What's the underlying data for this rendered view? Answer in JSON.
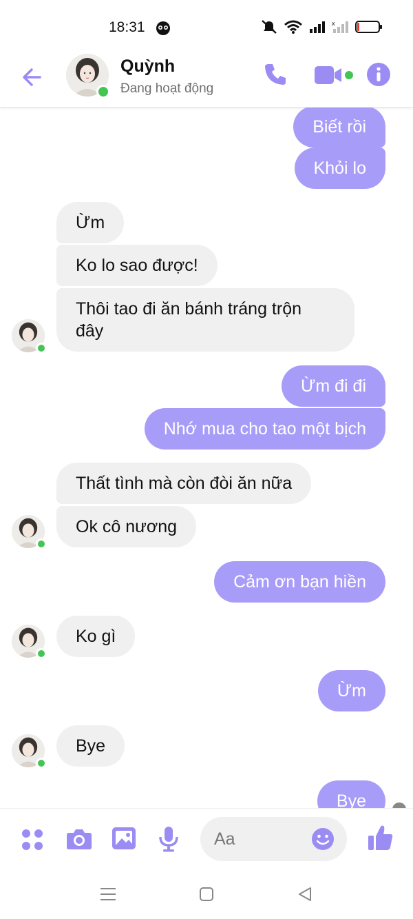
{
  "status_bar": {
    "time": "18:31"
  },
  "header": {
    "contact_name": "Quỳnh",
    "presence": "Đang hoạt động"
  },
  "messages": [
    {
      "from": "me",
      "text": "Biết rồi"
    },
    {
      "from": "me",
      "text": "Khỏi lo"
    },
    {
      "from": "them",
      "text": "Ừm"
    },
    {
      "from": "them",
      "text": "Ko lo sao được!"
    },
    {
      "from": "them",
      "text": "Thôi tao đi ăn bánh tráng trộn"
    },
    {
      "from": "them",
      "text": "đây"
    },
    {
      "from": "me",
      "text": "Ừm đi đi"
    },
    {
      "from": "me",
      "text": "Nhớ mua cho tao một bịch"
    },
    {
      "from": "them",
      "text": "Thất tình mà còn đòi ăn nữa"
    },
    {
      "from": "them",
      "text": "Ok cô nương"
    },
    {
      "from": "me",
      "text": "Cảm ơn bạn hiền"
    },
    {
      "from": "them",
      "text": "Ko gì"
    },
    {
      "from": "me",
      "text": "Ừm"
    },
    {
      "from": "them",
      "text": "Bye"
    },
    {
      "from": "me",
      "text": "Bye"
    }
  ],
  "composer": {
    "placeholder": "Aa"
  },
  "colors": {
    "accent": "#a89cf9",
    "icon": "#9b8cf3",
    "online": "#44c553",
    "bubble_them": "#f0f0f0"
  }
}
